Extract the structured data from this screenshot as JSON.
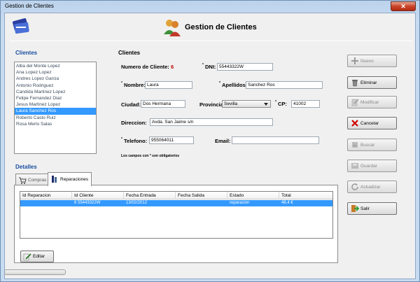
{
  "window": {
    "title": "Gestion de Clientes",
    "close_glyph": "✕"
  },
  "header": {
    "title": "Gestion de Clientes"
  },
  "clients_panel": {
    "label": "Clientes",
    "items": [
      "Alba del Monte Lopez",
      "Ana Lopez Lopez",
      "Andres Lopez Garcia",
      "Antonio Rodriguez",
      "Candida Martinez Lopez",
      "Felipe Fernandez Diaz",
      "Jesus Martinez Lopez",
      "Laura Sanchez Ros",
      "Roberto Casto Ruiz",
      "Rosa Merlo Salas"
    ],
    "selected_index": 7
  },
  "form": {
    "section_label": "Clientes",
    "numero_label": "Numero de Cliente:",
    "numero_value": "6",
    "dni_label": "DNI:",
    "dni_value": "55443322W",
    "nombre_label": "Nombre:",
    "nombre_value": "Laura",
    "apellidos_label": "Apellidos:",
    "apellidos_value": "Sanchez Ros",
    "ciudad_label": "Ciudad:",
    "ciudad_value": "Dos Hermana",
    "provincia_label": "Provincia:",
    "provincia_value": "Sevilla",
    "cp_label": "CP:",
    "cp_value": "41002",
    "direccion_label": "Direccion:",
    "direccion_value": "Avda. San Jaime s/n",
    "telefono_label": "Telefono:",
    "telefono_value": "955064011",
    "email_label": "Email:",
    "email_value": "",
    "required_marker": "*",
    "hint": "Los campos con * son obligatorios"
  },
  "buttons": {
    "nuevo": "Nuevo",
    "eliminar": "Eliminar",
    "modificar": "Modificar",
    "cancelar": "Cancelar",
    "buscar": "Buscar",
    "guardar": "Guardar",
    "actualizar": "Actualizar",
    "salir": "Salir"
  },
  "details": {
    "label": "Detalles",
    "tabs": [
      {
        "label": "Compras"
      },
      {
        "label": "Reparaciones"
      }
    ],
    "active_tab": 1,
    "columns": [
      "Id Reparacion",
      "Id Cliente",
      "Fecha Entrada",
      "Fecha Salida",
      "Estado",
      "Total"
    ],
    "rows": [
      {
        "id_reparacion": "",
        "id_cliente": "6 55443322W",
        "fecha_entrada": "13/02/2012",
        "fecha_salida": "",
        "estado": "reparacion",
        "total": "46,4 €"
      }
    ],
    "edit_button": "Editar"
  },
  "colors": {
    "accent": "#3399ff",
    "section_label": "#1a4ea0",
    "number_value": "#c00000"
  }
}
